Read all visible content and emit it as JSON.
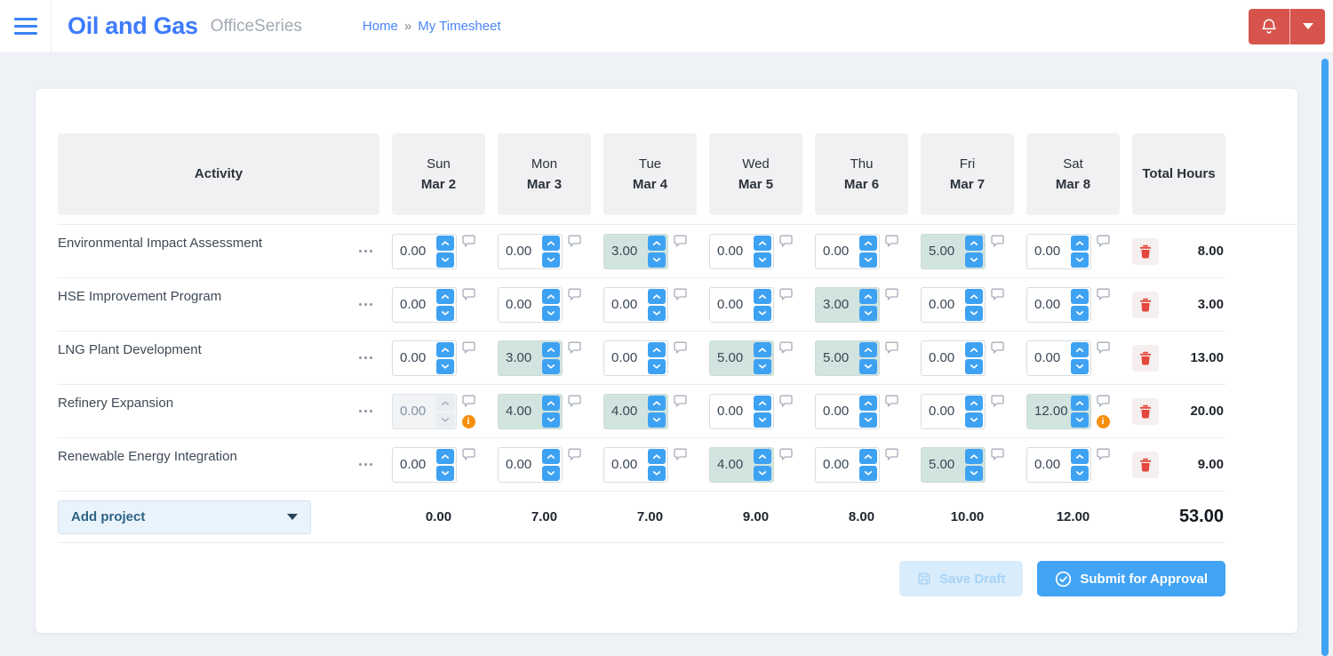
{
  "header": {
    "brand": "Oil and Gas",
    "suite": "OfficeSeries",
    "breadcrumb": {
      "home": "Home",
      "separator": "»",
      "current": "My Timesheet"
    }
  },
  "table": {
    "activity_header": "Activity",
    "total_header": "Total Hours",
    "days": [
      {
        "day": "Sun",
        "date": "Mar 2"
      },
      {
        "day": "Mon",
        "date": "Mar 3"
      },
      {
        "day": "Tue",
        "date": "Mar 4"
      },
      {
        "day": "Wed",
        "date": "Mar 5"
      },
      {
        "day": "Thu",
        "date": "Mar 6"
      },
      {
        "day": "Fri",
        "date": "Mar 7"
      },
      {
        "day": "Sat",
        "date": "Mar 8"
      }
    ],
    "rows": [
      {
        "name": "Environmental Impact Assessment",
        "total": "8.00",
        "cells": [
          {
            "value": "0.00"
          },
          {
            "value": "0.00"
          },
          {
            "value": "3.00",
            "filled": true
          },
          {
            "value": "0.00"
          },
          {
            "value": "0.00"
          },
          {
            "value": "5.00",
            "filled": true
          },
          {
            "value": "0.00"
          }
        ]
      },
      {
        "name": "HSE Improvement Program",
        "total": "3.00",
        "cells": [
          {
            "value": "0.00"
          },
          {
            "value": "0.00"
          },
          {
            "value": "0.00"
          },
          {
            "value": "0.00"
          },
          {
            "value": "3.00",
            "filled": true
          },
          {
            "value": "0.00"
          },
          {
            "value": "0.00"
          }
        ]
      },
      {
        "name": "LNG Plant Development",
        "total": "13.00",
        "cells": [
          {
            "value": "0.00"
          },
          {
            "value": "3.00",
            "filled": true
          },
          {
            "value": "0.00"
          },
          {
            "value": "5.00",
            "filled": true
          },
          {
            "value": "5.00",
            "filled": true
          },
          {
            "value": "0.00"
          },
          {
            "value": "0.00"
          }
        ]
      },
      {
        "name": "Refinery Expansion",
        "total": "20.00",
        "cells": [
          {
            "value": "0.00",
            "disabled": true,
            "alert": true
          },
          {
            "value": "4.00",
            "filled": true
          },
          {
            "value": "4.00",
            "filled": true
          },
          {
            "value": "0.00"
          },
          {
            "value": "0.00"
          },
          {
            "value": "0.00"
          },
          {
            "value": "12.00",
            "filled": true,
            "alert": true
          }
        ]
      },
      {
        "name": "Renewable Energy Integration",
        "total": "9.00",
        "cells": [
          {
            "value": "0.00"
          },
          {
            "value": "0.00"
          },
          {
            "value": "0.00"
          },
          {
            "value": "4.00",
            "filled": true
          },
          {
            "value": "0.00"
          },
          {
            "value": "5.00",
            "filled": true
          },
          {
            "value": "0.00"
          }
        ]
      }
    ],
    "add_project_label": "Add project",
    "day_totals": [
      "0.00",
      "7.00",
      "7.00",
      "9.00",
      "8.00",
      "10.00",
      "12.00"
    ],
    "grand_total": "53.00"
  },
  "actions": {
    "save_draft": "Save Draft",
    "submit": "Submit for Approval"
  },
  "colors": {
    "brand_blue": "#3d7bfd",
    "accent_blue": "#41a4f5",
    "spinner_blue": "#3ea2f3",
    "danger_red": "#d6544c",
    "trash_red": "#e5483c",
    "filled_cell_teal": "#d2e4df",
    "alert_orange": "#f78f0e"
  }
}
